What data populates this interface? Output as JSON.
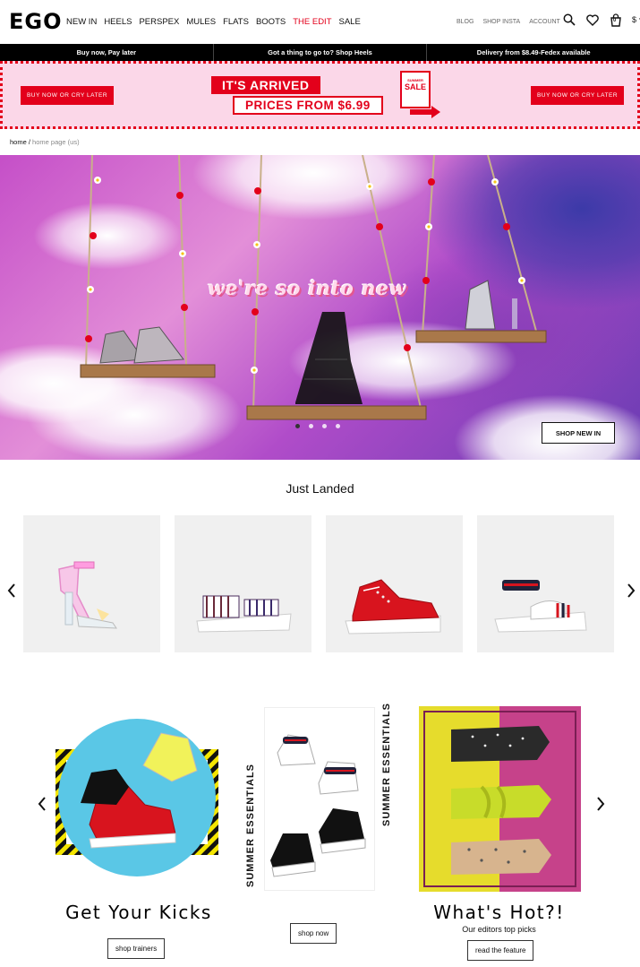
{
  "header": {
    "logo": "EGO",
    "nav": [
      {
        "label": "NEW IN",
        "highlight": false
      },
      {
        "label": "HEELS",
        "highlight": false
      },
      {
        "label": "PERSPEX",
        "highlight": false
      },
      {
        "label": "MULES",
        "highlight": false
      },
      {
        "label": "FLATS",
        "highlight": false
      },
      {
        "label": "BOOTS",
        "highlight": false
      },
      {
        "label": "THE EDIT",
        "highlight": true
      },
      {
        "label": "SALE",
        "highlight": false
      }
    ],
    "utility": [
      "BLOG",
      "SHOP INSTA",
      "ACCOUNT"
    ],
    "bag_count": "0",
    "currency": "$",
    "icons": [
      "search-icon",
      "heart-icon",
      "bag-icon",
      "chevron-down-icon"
    ]
  },
  "promo_bar": [
    "Buy now, Pay later",
    "Got a thing to go to? Shop Heels",
    "Delivery from $8.49-Fedex available"
  ],
  "banner": {
    "left_button": "BUY NOW OR CRY LATER",
    "right_button": "BUY NOW OR CRY LATER",
    "headline": "IT'S ARRIVED",
    "subline": "PRICES FROM $6.99",
    "tag_small": "SUMMER",
    "tag_main": "SALE"
  },
  "breadcrumb": {
    "home": "home",
    "sep": "/",
    "current": "home page (us)"
  },
  "hero": {
    "title": "we're so into new",
    "button": "SHOP NEW IN",
    "slide_count": 4,
    "active_slide": 1
  },
  "just_landed": {
    "title": "Just Landed",
    "products": [
      "clear-block-heel-sandal",
      "striped-chunky-sandal",
      "red-chunky-trainer",
      "white-stripe-sandal"
    ]
  },
  "tiles": [
    {
      "title": "Get Your Kicks",
      "button": "shop trainers"
    },
    {
      "vertical_label": "SUMMER ESSENTIALS",
      "button": "shop now"
    },
    {
      "title": "What's Hot?!",
      "subtitle": "Our editors top picks",
      "button": "read the feature"
    }
  ],
  "colors": {
    "accent": "#e3001b",
    "banner_bg": "#fbd7e8",
    "bar_bg": "#000000"
  }
}
